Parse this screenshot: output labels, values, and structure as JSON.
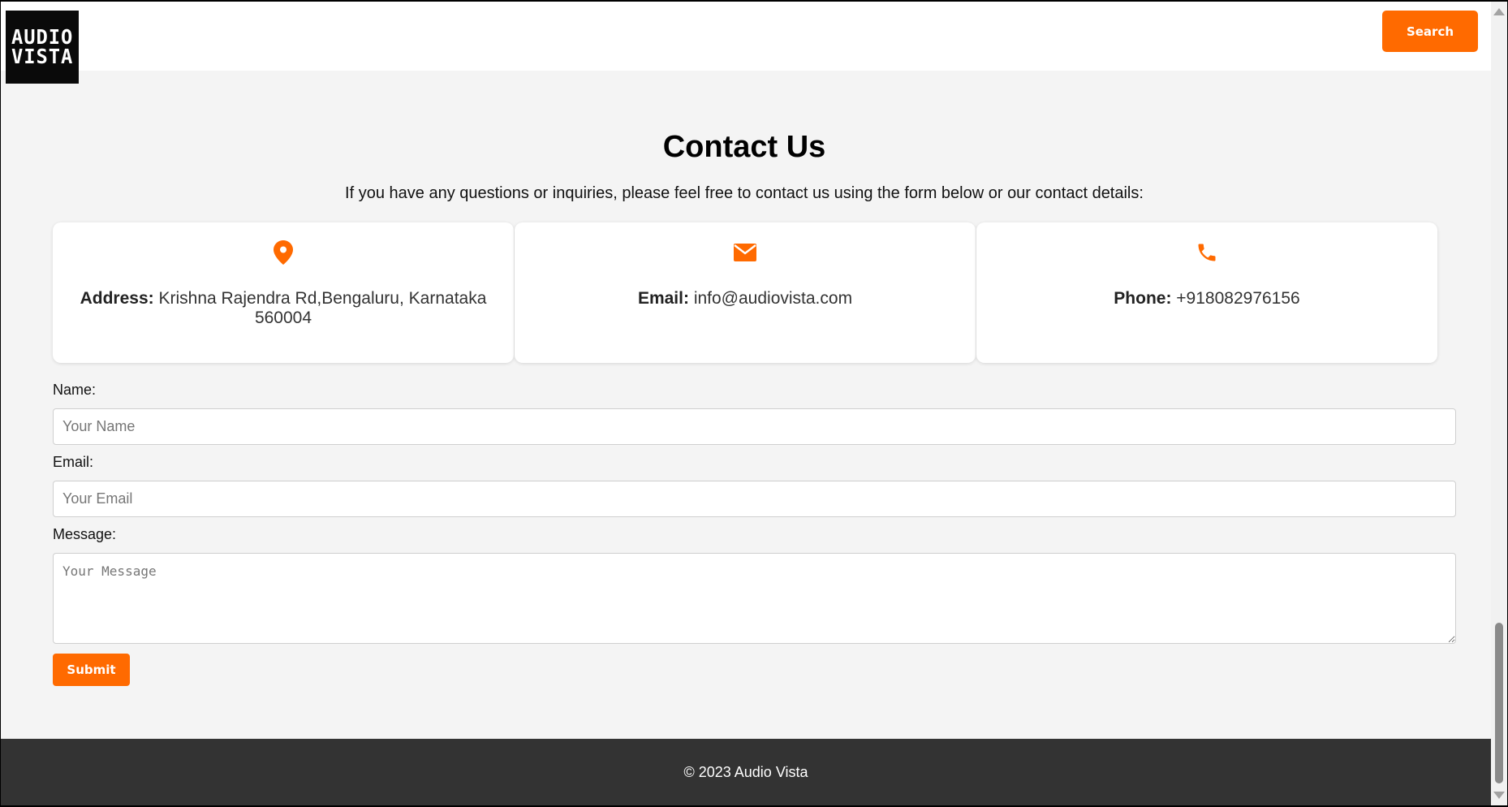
{
  "header": {
    "logo_line1": "AUDIO",
    "logo_line2": "VISTA",
    "search_label": "Search"
  },
  "contact": {
    "title": "Contact Us",
    "intro": "If you have any questions or inquiries, please feel free to contact us using the form below or our contact details:",
    "cards": [
      {
        "icon": "location-pin-icon",
        "label": "Address:",
        "value": "Krishna Rajendra Rd,Bengaluru, Karnataka 560004"
      },
      {
        "icon": "envelope-icon",
        "label": "Email:",
        "value": "info@audiovista.com"
      },
      {
        "icon": "phone-icon",
        "label": "Phone:",
        "value": "+918082976156"
      }
    ]
  },
  "form": {
    "name_label": "Name:",
    "name_placeholder": "Your Name",
    "email_label": "Email:",
    "email_placeholder": "Your Email",
    "message_label": "Message:",
    "message_placeholder": "Your Message",
    "submit_label": "Submit"
  },
  "footer": {
    "text": "© 2023 Audio Vista"
  },
  "colors": {
    "accent": "#ff6a00",
    "footer_bg": "#333333",
    "page_bg": "#f4f4f4"
  }
}
